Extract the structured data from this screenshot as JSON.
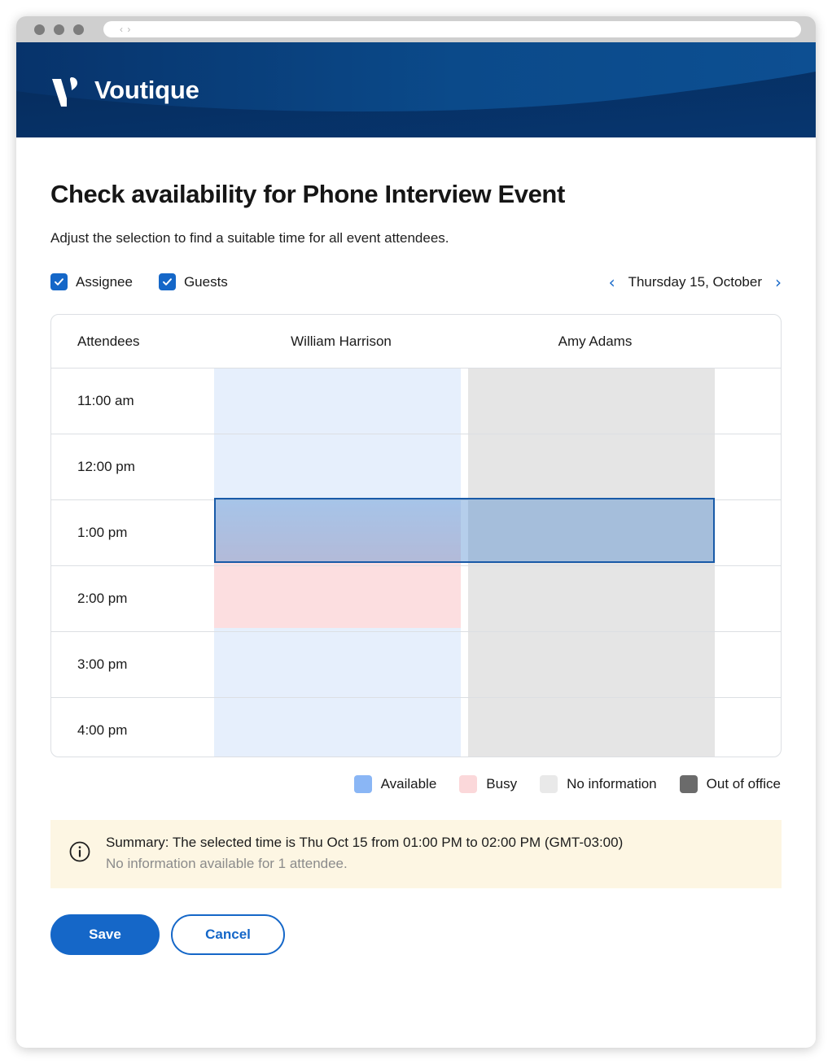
{
  "browser": {
    "address_glyph": "‹ ›"
  },
  "brand": {
    "name": "Voutique",
    "logo_icon": "voutique-v-logo",
    "header_color": "#052f63",
    "header_wave_color": "#0d4a86"
  },
  "page": {
    "title": "Check availability for Phone Interview Event",
    "subtitle": "Adjust the selection to find a suitable time for all event attendees."
  },
  "filters": [
    {
      "label": "Assignee",
      "checked": true
    },
    {
      "label": "Guests",
      "checked": true
    }
  ],
  "date_nav": {
    "prev_icon": "chevron-left-icon",
    "next_icon": "chevron-right-icon",
    "label": "Thursday 15, October"
  },
  "grid": {
    "columns": [
      "Attendees",
      "William Harrison",
      "Amy Adams"
    ],
    "rows": [
      {
        "time": "11:00 am",
        "william": "available",
        "amy": "no-information"
      },
      {
        "time": "12:00 pm",
        "william": "available",
        "amy": "no-information"
      },
      {
        "time": "1:00 pm",
        "william": "available",
        "amy": "no-information",
        "selected": true
      },
      {
        "time": "2:00 pm",
        "william": "busy",
        "amy": "no-information"
      },
      {
        "time": "3:00 pm",
        "william": "available",
        "amy": "no-information"
      },
      {
        "time": "4:00 pm",
        "william": "available",
        "amy": "no-information"
      }
    ],
    "selection": {
      "start": "1:00 pm",
      "end": "2:00 pm"
    }
  },
  "legend": [
    {
      "label": "Available",
      "color": "#e6effc",
      "swatch": "#89b6f7"
    },
    {
      "label": "Busy",
      "color": "#fcdee0",
      "swatch": "#fbd7da"
    },
    {
      "label": "No information",
      "color": "#e5e5e5",
      "swatch": "#eaeaea"
    },
    {
      "label": "Out of office",
      "color": "#6b6b6b",
      "swatch": "#6b6b6b"
    }
  ],
  "summary": {
    "icon": "info-circle-icon",
    "line1": "Summary: The selected time is Thu Oct 15 from 01:00 PM to 02:00 PM (GMT-03:00)",
    "line2": "No information available for 1 attendee.",
    "background": "#fdf6e3"
  },
  "actions": {
    "save_label": "Save",
    "cancel_label": "Cancel",
    "accent": "#1567c8"
  }
}
